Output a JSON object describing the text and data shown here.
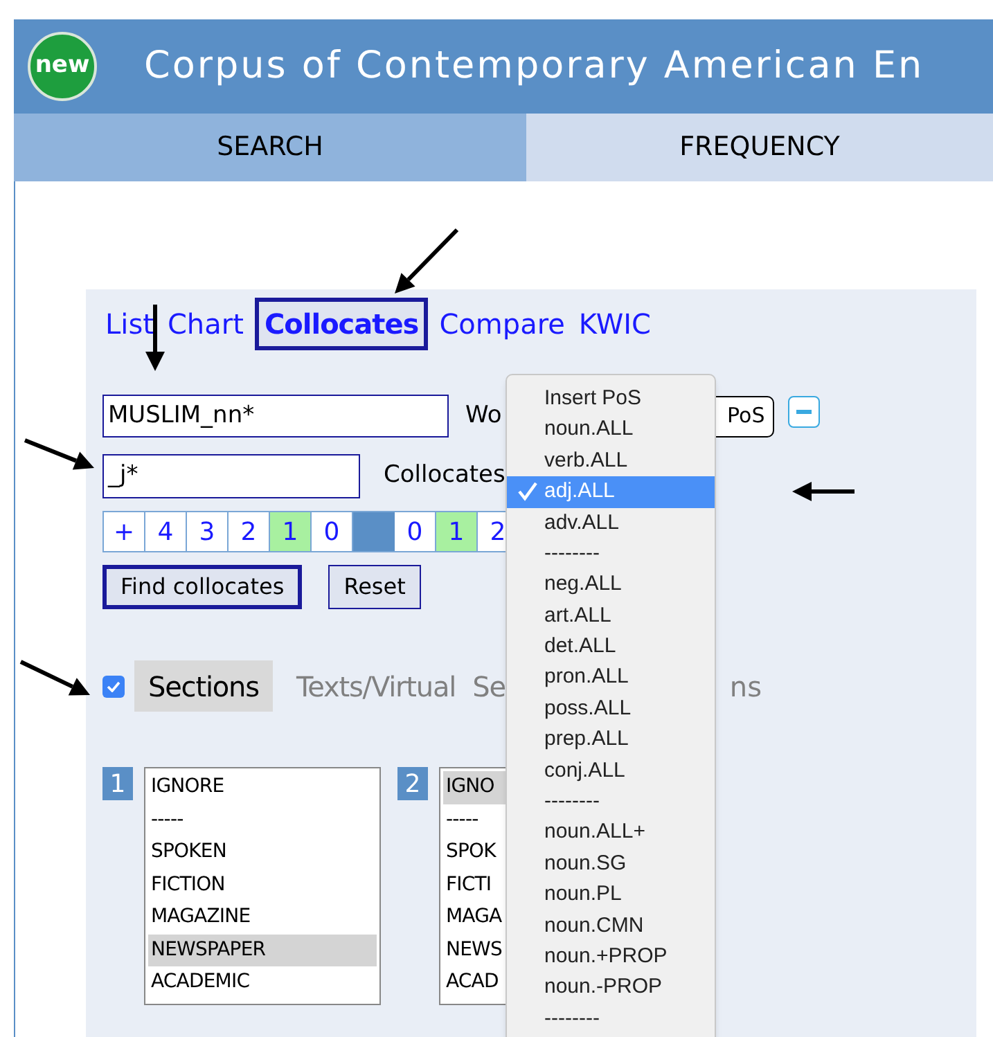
{
  "header": {
    "badge": "new",
    "title": "Corpus of Contemporary American En"
  },
  "tabs": [
    {
      "label": "SEARCH",
      "selected": true
    },
    {
      "label": "FREQUENCY",
      "selected": false
    }
  ],
  "modes": [
    {
      "label": "List",
      "selected": false
    },
    {
      "label": "Chart",
      "selected": false
    },
    {
      "label": "Collocates",
      "selected": true
    },
    {
      "label": "Compare",
      "selected": false
    },
    {
      "label": "KWIC",
      "selected": false
    }
  ],
  "word_field": {
    "value": "MUSLIM_nn*",
    "label": "Wo",
    "pos_value": "PoS"
  },
  "collocates_field": {
    "value": "_j*",
    "label": "Collocates"
  },
  "span": [
    {
      "kind": "cell",
      "label": "+",
      "highlighted": false
    },
    {
      "kind": "cell",
      "label": "4",
      "highlighted": false
    },
    {
      "kind": "cell",
      "label": "3",
      "highlighted": false
    },
    {
      "kind": "cell",
      "label": "2",
      "highlighted": false
    },
    {
      "kind": "cell",
      "label": "1",
      "highlighted": true
    },
    {
      "kind": "cell",
      "label": "0",
      "highlighted": false
    },
    {
      "kind": "spacer"
    },
    {
      "kind": "cell",
      "label": "0",
      "highlighted": false
    },
    {
      "kind": "cell",
      "label": "1",
      "highlighted": true
    },
    {
      "kind": "cell",
      "label": "2",
      "highlighted": false
    }
  ],
  "buttons": [
    "Find collocates",
    "Reset"
  ],
  "sections": {
    "checked": true,
    "tabs": [
      {
        "label": "Sections",
        "selected": true
      },
      {
        "label": "Texts/Virtual",
        "selected": false
      }
    ],
    "hidden_tab_start": "Se",
    "hidden_tab_end": "ns"
  },
  "lists": [
    {
      "number": "1",
      "items": [
        {
          "label": "IGNORE",
          "selected": false
        },
        {
          "label": "-----",
          "selected": false
        },
        {
          "label": "SPOKEN",
          "selected": false
        },
        {
          "label": "FICTION",
          "selected": false
        },
        {
          "label": "MAGAZINE",
          "selected": false
        },
        {
          "label": "NEWSPAPER",
          "selected": true
        },
        {
          "label": "ACADEMIC",
          "selected": false
        }
      ]
    },
    {
      "number": "2",
      "items": [
        {
          "label": "IGNO",
          "selected": true
        },
        {
          "label": "-----",
          "selected": false
        },
        {
          "label": "SPOK",
          "selected": false
        },
        {
          "label": "FICTI",
          "selected": false
        },
        {
          "label": "MAGA",
          "selected": false
        },
        {
          "label": "NEWS",
          "selected": false
        },
        {
          "label": "ACAD",
          "selected": false
        }
      ]
    }
  ],
  "pos_menu": [
    {
      "label": "Insert PoS",
      "selected": false
    },
    {
      "label": "noun.ALL",
      "selected": false
    },
    {
      "label": "verb.ALL",
      "selected": false
    },
    {
      "label": "adj.ALL",
      "selected": true
    },
    {
      "label": "adv.ALL",
      "selected": false
    },
    {
      "label": "--------",
      "selected": false
    },
    {
      "label": "neg.ALL",
      "selected": false
    },
    {
      "label": "art.ALL",
      "selected": false
    },
    {
      "label": "det.ALL",
      "selected": false
    },
    {
      "label": "pron.ALL",
      "selected": false
    },
    {
      "label": "poss.ALL",
      "selected": false
    },
    {
      "label": "prep.ALL",
      "selected": false
    },
    {
      "label": "conj.ALL",
      "selected": false
    },
    {
      "label": "--------",
      "selected": false
    },
    {
      "label": "noun.ALL+",
      "selected": false
    },
    {
      "label": "noun.SG",
      "selected": false
    },
    {
      "label": "noun.PL",
      "selected": false
    },
    {
      "label": "noun.CMN",
      "selected": false
    },
    {
      "label": "noun.+PROP",
      "selected": false
    },
    {
      "label": "noun.-PROP",
      "selected": false
    },
    {
      "label": "--------",
      "selected": false
    }
  ]
}
